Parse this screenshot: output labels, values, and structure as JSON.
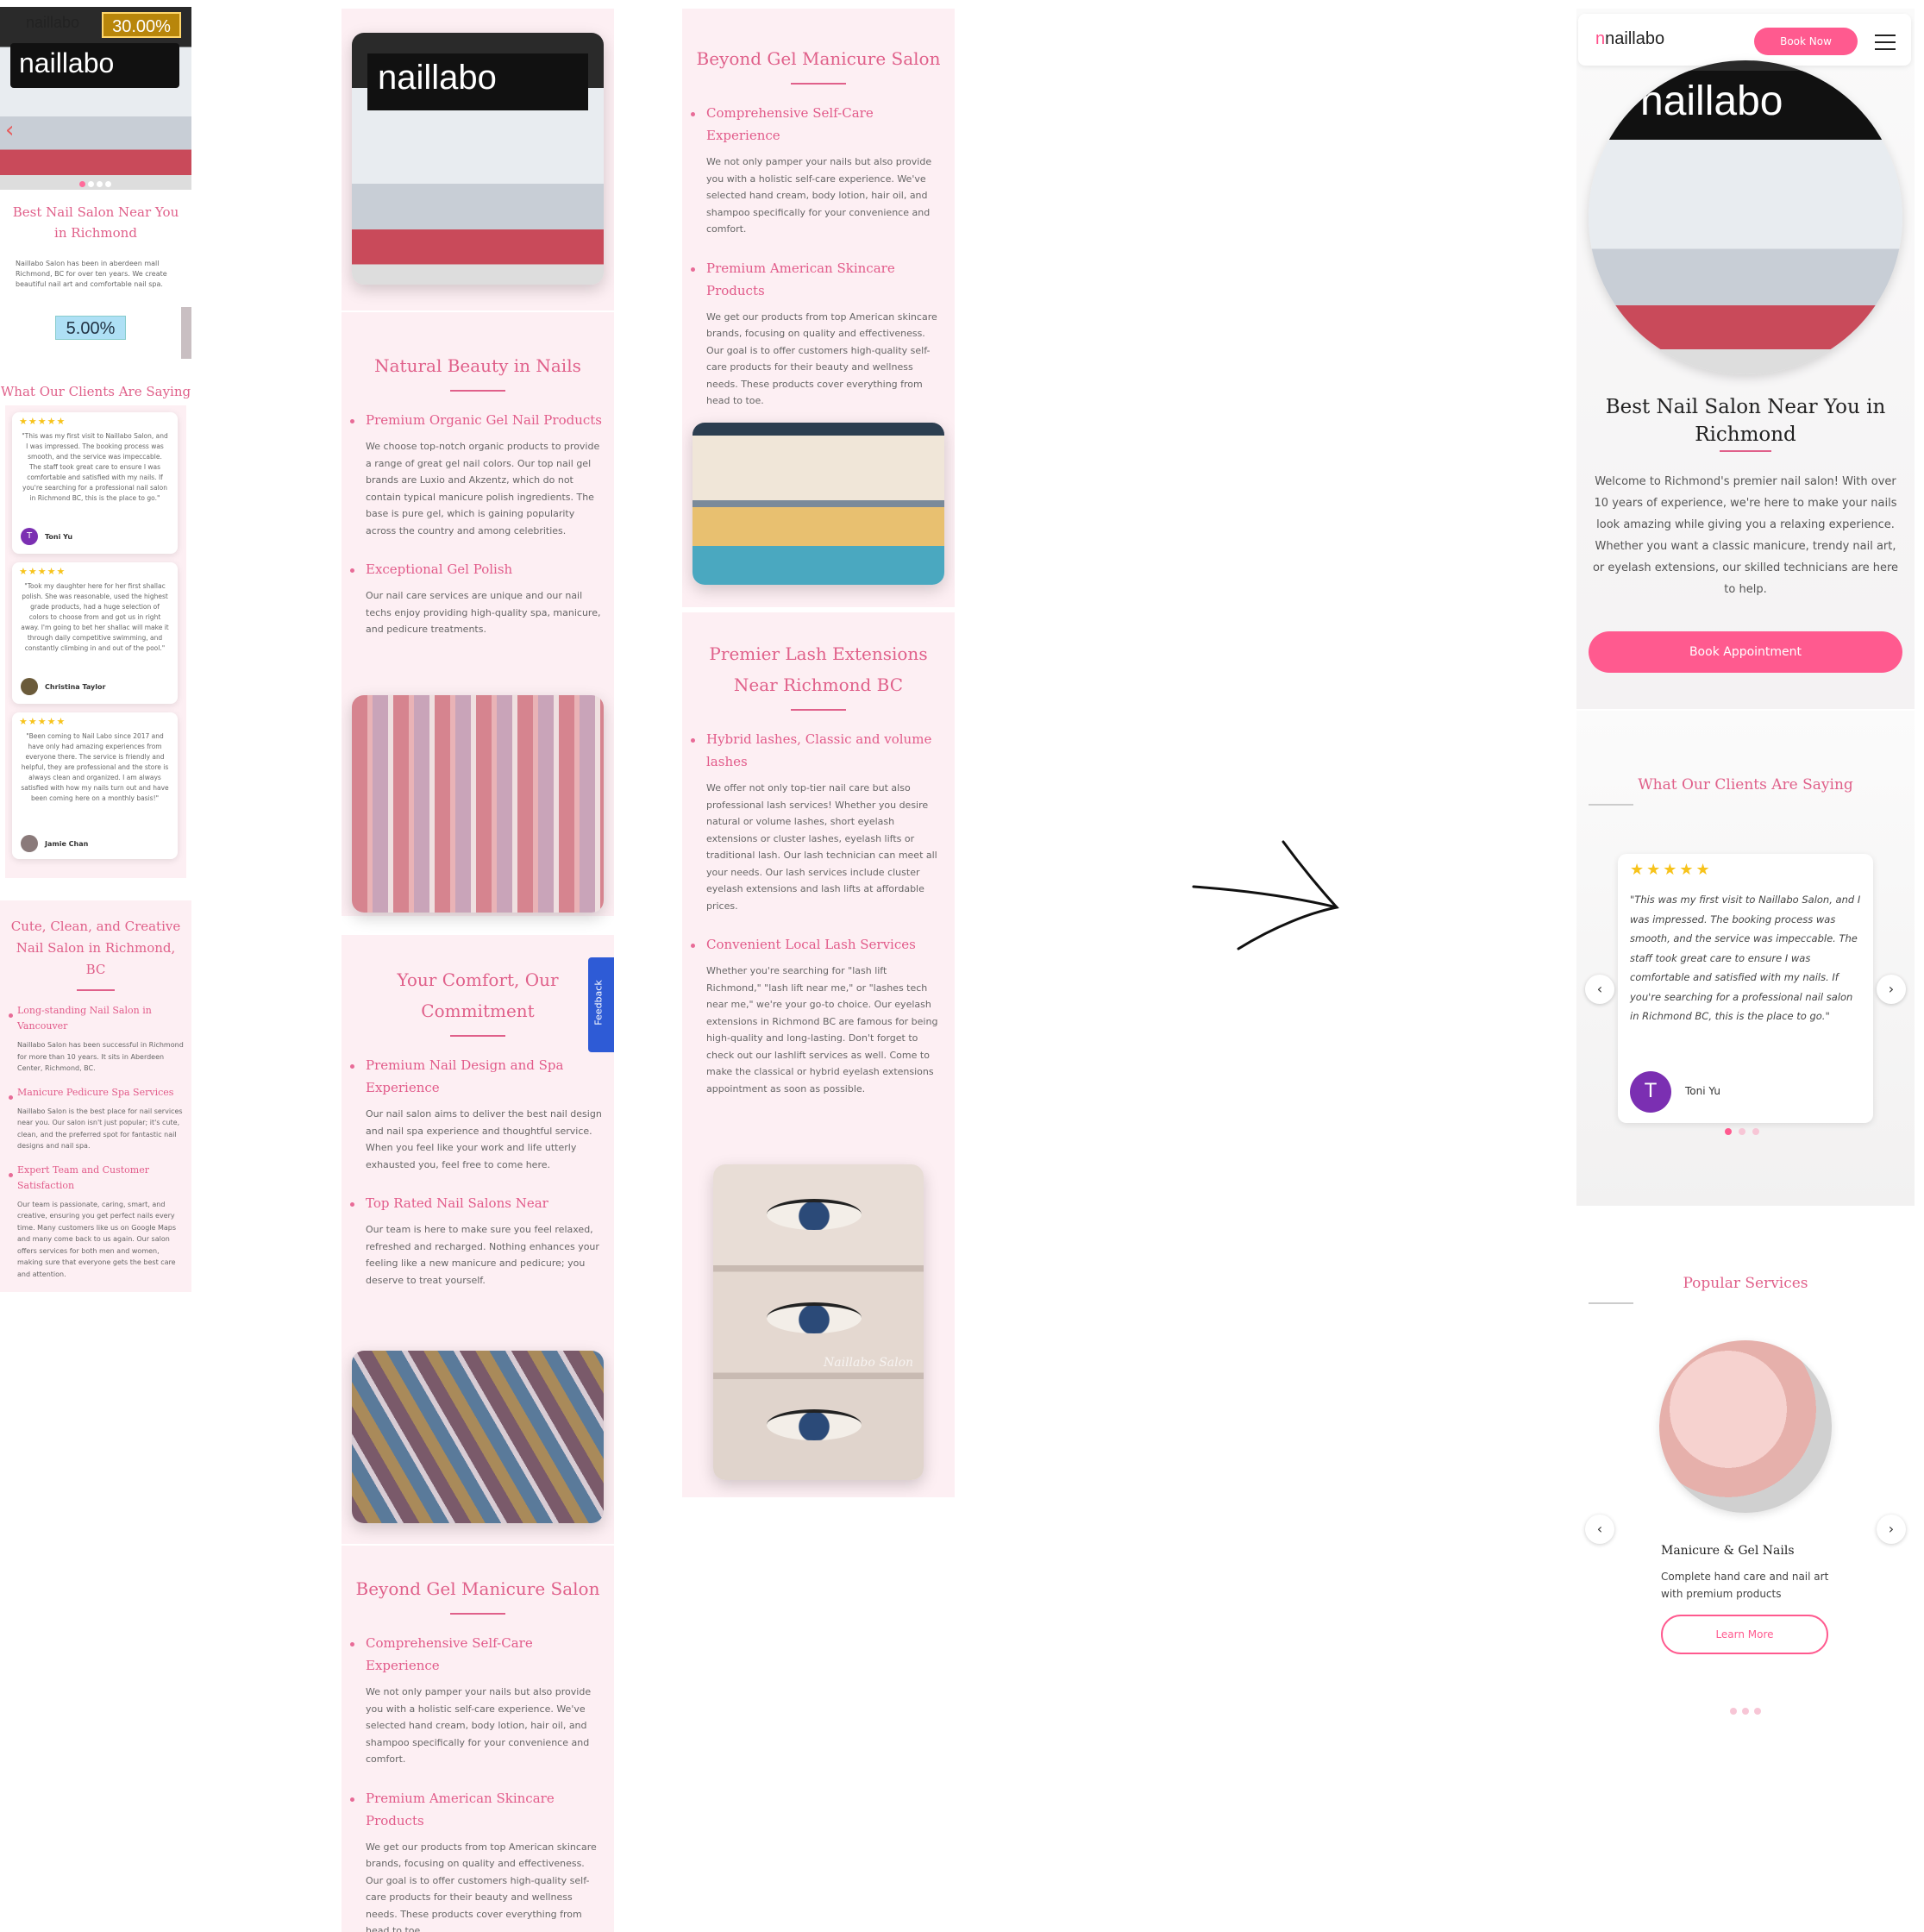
{
  "badges": {
    "top": "30.00%",
    "bottom": "5.00%"
  },
  "col1": {
    "logo": "naillabo",
    "title": "Best Nail Salon Near You in Richmond",
    "intro": "Naillabo Salon has been in aberdeen mall Richmond, BC for over ten years. We create beautiful nail art and comfortable nail spa.",
    "reviews_title": "What Our Clients Are Saying",
    "reviews": [
      {
        "stars": "★★★★★",
        "text": "\"This was my first visit to Naillabo Salon, and I was impressed. The booking process was smooth, and the service was impeccable. The staff took great care to ensure I was comfortable and satisfied with my nails. If you're searching for a professional nail salon in Richmond BC, this is the place to go.\"",
        "name": "Toni Yu",
        "initial": "T"
      },
      {
        "stars": "★★★★★",
        "text": "\"Took my daughter here for her first shallac polish. She was reasonable, used the highest grade products, had a huge selection of colors to choose from and got us in right away. I'm going to bet her shallac will make it through daily competitive swimming, and constantly climbing in and out of the pool.\"",
        "name": "Christina Taylor",
        "initial": ""
      },
      {
        "stars": "★★★★★",
        "text": "\"Been coming to Nail Labo since 2017 and have only had amazing experiences from everyone there. The service is friendly and helpful, they are professional and the store is always clean and organized. I am always satisfied with how my nails turn out and have been coming here on a monthly basis!\"",
        "name": "Jamie Chan",
        "initial": ""
      }
    ],
    "about_title": "Cute, Clean, and Creative Nail Salon in Richmond, BC",
    "about": [
      {
        "h": "Long-standing Nail Salon in Vancouver",
        "p": "Naillabo Salon has been successful in Richmond for more than 10 years. It sits in Aberdeen Center, Richmond, BC."
      },
      {
        "h": "Manicure Pedicure Spa Services",
        "p": "Naillabo Salon is the best place for nail services near you. Our salon isn't just popular; it's cute, clean, and the preferred spot for fantastic nail designs and nail spa."
      },
      {
        "h": "Expert Team and Customer Satisfaction",
        "p": "Our team is passionate, caring, smart, and creative, ensuring you get perfect nails every time. Many customers like us on Google Maps and many come back to us again. Our salon offers services for both men and women, making sure that everyone gets the best care and attention."
      }
    ]
  },
  "col2": {
    "natural_title": "Natural Beauty in Nails",
    "natural": [
      {
        "h": "Premium Organic Gel Nail Products",
        "p": "We choose top-notch organic products to provide a range of great gel nail colors. Our top nail gel brands are Luxio and Akzentz, which do not contain typical manicure polish ingredients. The base is pure gel, which is gaining popularity across the country and among celebrities."
      },
      {
        "h": "Exceptional Gel Polish",
        "p": "Our nail care services are unique and our nail techs enjoy providing high-quality spa, manicure, and pedicure treatments."
      }
    ],
    "comfort_title": "Your Comfort, Our Commitment",
    "comfort": [
      {
        "h": "Premium Nail Design and Spa Experience",
        "p": "Our nail salon aims to deliver the best nail design and nail spa experience and thoughtful service. When you feel like your work and life utterly exhausted you, feel free to come here."
      },
      {
        "h": "Top Rated Nail Salons Near",
        "p": "Our team is here to make sure you feel relaxed, refreshed and recharged. Nothing enhances your feeling like a new manicure and pedicure; you deserve to treat yourself."
      }
    ],
    "feedback": "Feedback",
    "beyond_title": "Beyond Gel Manicure Salon",
    "beyond": [
      {
        "h": "Comprehensive Self-Care Experience",
        "p": "We not only pamper your nails but also provide you with a holistic self-care experience. We've selected hand cream, body lotion, hair oil, and shampoo specifically for your convenience and comfort."
      },
      {
        "h": "Premium American Skincare Products",
        "p": "We get our products from top American skincare brands, focusing on quality and effectiveness. Our goal is to offer customers high-quality self-care products for their beauty and wellness needs. These products cover everything from head to toe."
      }
    ]
  },
  "col3": {
    "beyond_title": "Beyond Gel Manicure Salon",
    "beyond": [
      {
        "h": "Comprehensive Self-Care Experience",
        "p": "We not only pamper your nails but also provide you with a holistic self-care experience. We've selected hand cream, body lotion, hair oil, and shampoo specifically for your convenience and comfort."
      },
      {
        "h": "Premium American Skincare Products",
        "p": "We get our products from top American skincare brands, focusing on quality and effectiveness. Our goal is to offer customers high-quality self-care products for their beauty and wellness needs. These products cover everything from head to toe."
      }
    ],
    "lash_title": "Premier Lash Extensions Near Richmond BC",
    "lash": [
      {
        "h": "Hybrid lashes, Classic and volume lashes",
        "p": "We offer not only top-tier nail care but also professional lash services! Whether you desire natural or volume lashes, short eyelash extensions or cluster lashes, eyelash lifts or traditional lash. Our lash technician can meet all your needs. Our lash services include cluster eyelash extensions and lash lifts at affordable prices."
      },
      {
        "h": "Convenient Local Lash Services",
        "p": "Whether you're searching for \"lash lift Richmond,\" \"lash lift near me,\" or \"lashes tech near me,\" we're your go-to choice. Our eyelash extensions in Richmond BC are famous for being high-quality and long-lasting. Don't forget to check out our lashlift services as well. Come to make the classical or hybrid eyelash extensions appointment as soon as possible."
      }
    ],
    "watermark": "Naillabo Salon"
  },
  "mobile": {
    "logo": "naillabo",
    "book_now": "Book Now",
    "title": "Best Nail Salon Near You in Richmond",
    "intro": "Welcome to Richmond's premier nail salon! With over 10 years of experience, we're here to make your nails look amazing while giving you a relaxing experience. Whether you want a classic manicure, trendy nail art, or eyelash extensions, our skilled technicians are here to help.",
    "book_appointment": "Book Appointment",
    "reviews_title": "What Our Clients Are Saying",
    "review": {
      "stars": "★★★★★",
      "text": "\"This was my first visit to Naillabo Salon, and I was impressed. The booking process was smooth, and the service was impeccable. The staff took great care to ensure I was comfortable and satisfied with my nails. If you're searching for a professional nail salon in Richmond BC, this is the place to go.\"",
      "name": "Toni Yu",
      "initial": "T"
    },
    "services_title": "Popular Services",
    "service": {
      "name": "Manicure & Gel Nails",
      "desc": "Complete hand care and nail art with premium products",
      "cta": "Learn More"
    }
  }
}
